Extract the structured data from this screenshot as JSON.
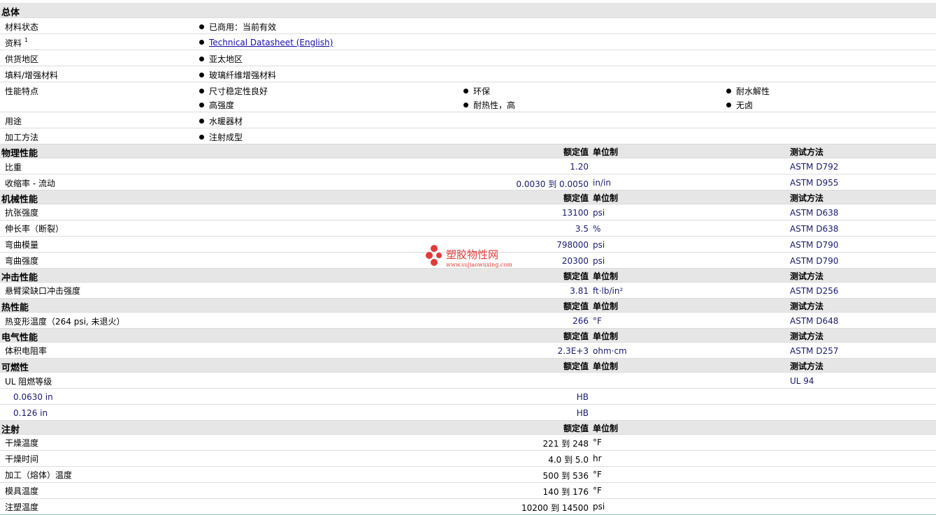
{
  "general": {
    "title": "总体",
    "material_status_label": "材料状态",
    "material_status_value": "已商用：当前有效",
    "docs_label": "资料",
    "docs_sup": "1",
    "docs_link": "Technical Datasheet (English)",
    "supply_label": "供货地区",
    "supply_value": "亚太地区",
    "filler_label": "填料/增强材料",
    "filler_value": "玻璃纤维增强材料",
    "features_label": "性能特点",
    "features": [
      "尺寸稳定性良好",
      "环保",
      "耐水解性",
      "高强度",
      "耐热性，高",
      "无卤"
    ],
    "uses_label": "用途",
    "uses_value": "水暖器材",
    "processing_label": "加工方法",
    "processing_value": "注射成型"
  },
  "col_headers": {
    "rated": "额定值",
    "unit": "单位制",
    "test": "测试方法"
  },
  "physical": {
    "title": "物理性能",
    "rows": [
      {
        "label": "比重",
        "value": "1.20",
        "unit": "",
        "test": "ASTM D792"
      },
      {
        "label": "收缩率 - 流动",
        "value": "0.0030 到  0.0050",
        "unit": "in/in",
        "test": "ASTM D955"
      }
    ]
  },
  "mechanical": {
    "title": "机械性能",
    "rows": [
      {
        "label": "抗张强度",
        "value": "13100",
        "unit": "psi",
        "test": "ASTM D638"
      },
      {
        "label": "伸长率（断裂）",
        "value": "3.5",
        "unit": "%",
        "test": "ASTM D638"
      },
      {
        "label": "弯曲模量",
        "value": "798000",
        "unit": "psi",
        "test": "ASTM D790"
      },
      {
        "label": "弯曲强度",
        "value": "20300",
        "unit": "psi",
        "test": "ASTM D790"
      }
    ]
  },
  "impact": {
    "title": "冲击性能",
    "rows": [
      {
        "label": "悬臂梁缺口冲击强度",
        "value": "3.81",
        "unit": "ft·lb/in²",
        "test": "ASTM D256"
      }
    ]
  },
  "thermal": {
    "title": "热性能",
    "rows": [
      {
        "label": "热变形温度（264 psi, 未退火）",
        "value": "266",
        "unit": "°F",
        "test": "ASTM D648"
      }
    ]
  },
  "electrical": {
    "title": "电气性能",
    "rows": [
      {
        "label": "体积电阻率",
        "value": "2.3E+3",
        "unit": "ohm·cm",
        "test": "ASTM D257"
      }
    ]
  },
  "flammability": {
    "title": "可燃性",
    "ul_label": "UL 阻燃等级",
    "ul_test": "UL 94",
    "rows": [
      {
        "label": "0.0630 in",
        "value": "HB"
      },
      {
        "label": "0.126 in",
        "value": "HB"
      }
    ]
  },
  "injection": {
    "title": "注射",
    "rows": [
      {
        "label": "干燥温度",
        "value": "221 到  248",
        "unit": "°F"
      },
      {
        "label": "干燥时间",
        "value": "4.0 到  5.0",
        "unit": "hr"
      },
      {
        "label": "加工（熔体）温度",
        "value": "500 到  536",
        "unit": "°F"
      },
      {
        "label": "模具温度",
        "value": "140 到  176",
        "unit": "°F"
      },
      {
        "label": "注塑温度",
        "value": "10200 到  14500",
        "unit": "psi"
      }
    ]
  },
  "watermark": {
    "cn": "塑胶物性网",
    "en": "www.sujiaowuxing.com"
  }
}
